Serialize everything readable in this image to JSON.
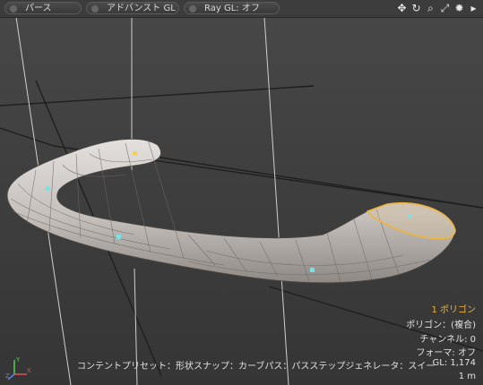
{
  "toolbar": {
    "perspective_label": "パース",
    "advanced_gl_label": "アドバンスト GL",
    "ray_gl_label": "Ray GL: オフ",
    "icons": [
      "move-view-icon",
      "rotate-view-icon",
      "zoom-view-icon",
      "maximize-view-icon",
      "settings-icon",
      "more-arrow-icon"
    ]
  },
  "info": {
    "selection": "1 ポリゴン",
    "polygon": "ポリゴン：(複合)",
    "channel": "チャンネル: 0",
    "former": "フォーマ: オフ",
    "gl": "GL: 1,174",
    "scale": "1 m"
  },
  "status": {
    "text": "コンテントプリセット：形状スナップ：カーブパス：パスステップジェネレータ：スイープエフェクタ"
  },
  "axes": {
    "x": "X",
    "y": "Y",
    "z": "Z"
  },
  "colors": {
    "selection": "#f0b43a",
    "mesh": "#c9c4c1",
    "grid": "#1f1f1f",
    "guide": "#c8c8c8",
    "vertex_marker": "#7fe0e0"
  }
}
